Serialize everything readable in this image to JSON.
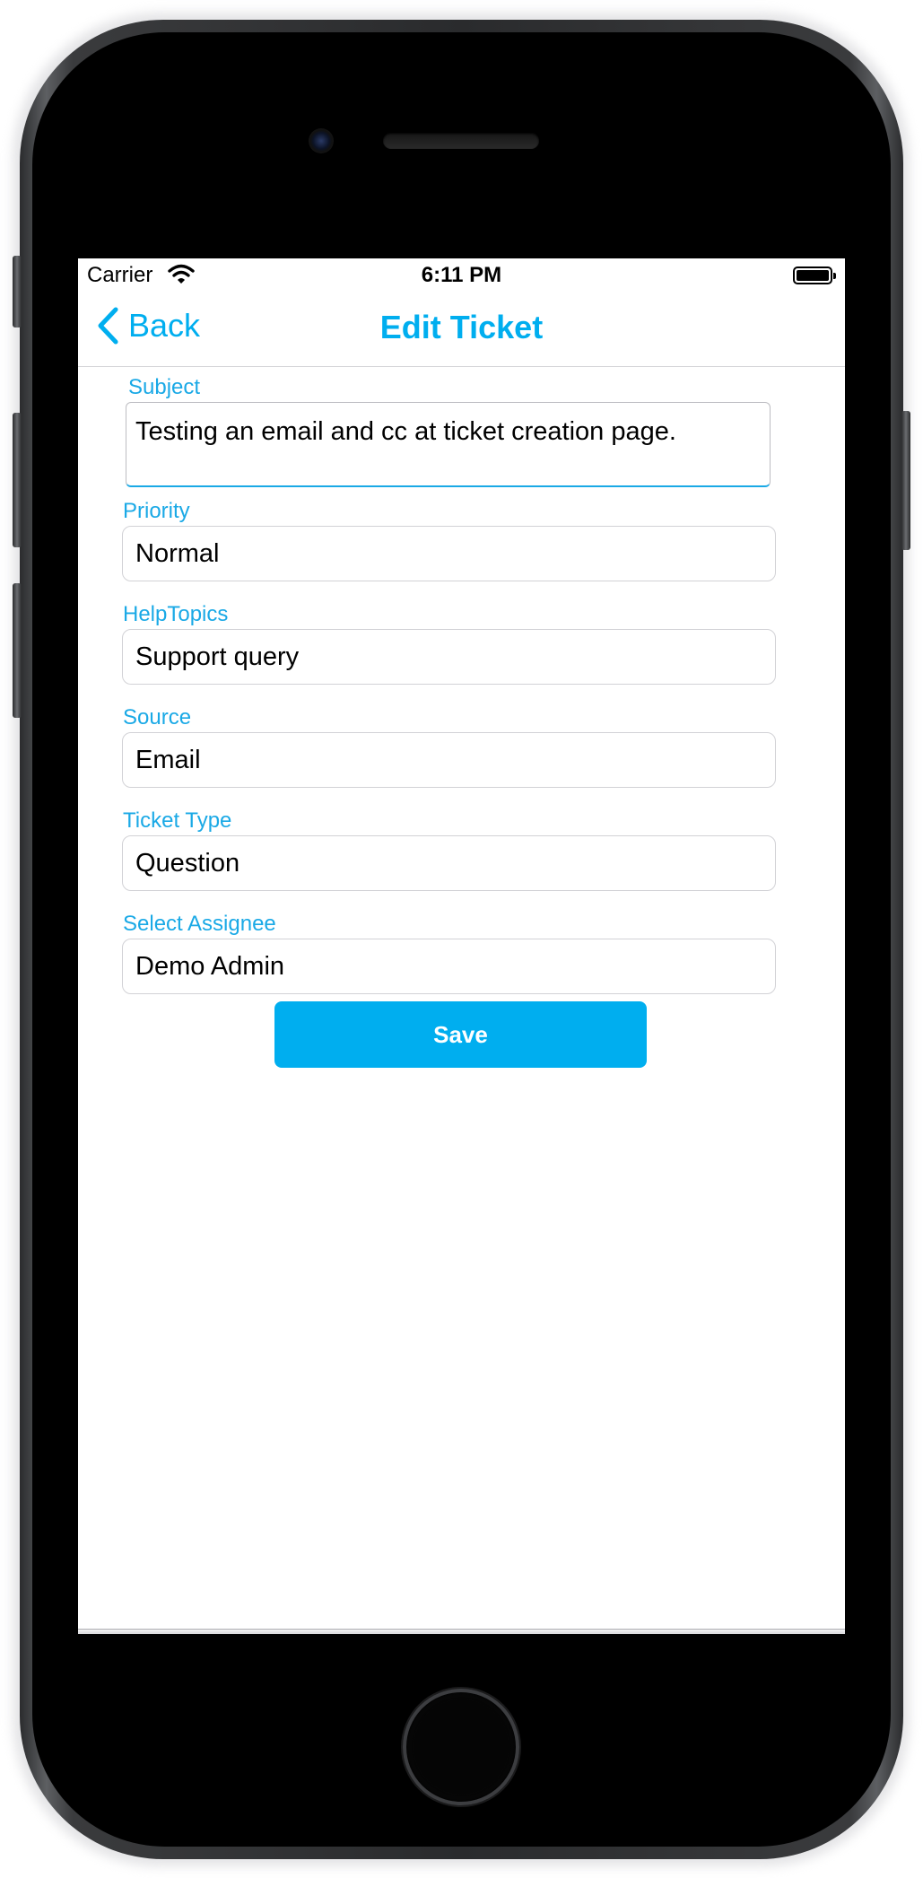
{
  "status_bar": {
    "carrier": "Carrier",
    "time": "6:11 PM"
  },
  "nav": {
    "back_label": "Back",
    "title": "Edit Ticket"
  },
  "form": {
    "subject": {
      "label": "Subject",
      "value": "Testing an email and cc at ticket creation page."
    },
    "priority": {
      "label": "Priority",
      "value": "Normal"
    },
    "help_topics": {
      "label": "HelpTopics",
      "value": "Support query"
    },
    "source": {
      "label": "Source",
      "value": "Email"
    },
    "ticket_type": {
      "label": "Ticket Type",
      "value": "Question"
    },
    "assignee": {
      "label": "Select Assignee",
      "value": "Demo Admin"
    }
  },
  "actions": {
    "save_label": "Save"
  },
  "colors": {
    "accent": "#00aeef",
    "label": "#1aa9e6",
    "border": "#d2d2d6"
  }
}
